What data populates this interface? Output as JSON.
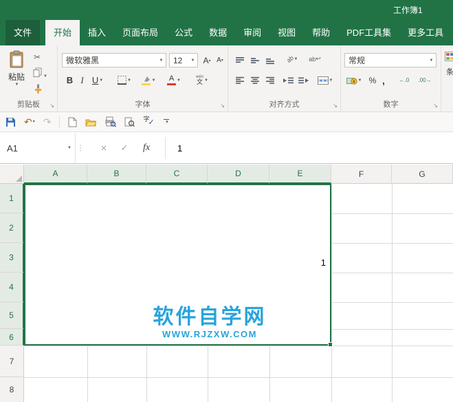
{
  "title_bar": {
    "workbook_name": "工作簿1"
  },
  "tabs": {
    "file": "文件",
    "items": [
      "开始",
      "插入",
      "页面布局",
      "公式",
      "数据",
      "审阅",
      "视图",
      "帮助",
      "PDF工具集",
      "更多工具"
    ],
    "active": "开始"
  },
  "ribbon": {
    "clipboard": {
      "group_label": "剪贴板",
      "paste_label": "粘贴"
    },
    "font": {
      "group_label": "字体",
      "name": "微软雅黑",
      "size": "12",
      "bold": "B",
      "italic": "I",
      "underline": "U",
      "grow": "A",
      "shrink": "A",
      "color_letter": "A",
      "phonetic_top": "wén",
      "phonetic_char": "文"
    },
    "alignment": {
      "group_label": "对齐方式",
      "orientation_text": "ab",
      "wrap_text": "ab"
    },
    "number": {
      "group_label": "数字",
      "format": "常规",
      "currency": "¥",
      "percent": "%",
      "comma": ",",
      "inc_decimal": "←.0",
      "dec_decimal": ".00→"
    },
    "conditional": {
      "label": "条"
    }
  },
  "formula_bar": {
    "name_box": "A1",
    "fx": "fx",
    "value": "1"
  },
  "grid": {
    "columns": [
      "A",
      "B",
      "C",
      "D",
      "E",
      "F",
      "G"
    ],
    "rows": [
      "1",
      "2",
      "3",
      "4",
      "5",
      "6",
      "7",
      "8"
    ],
    "selection_range": "A1:E6",
    "cell_value": "1",
    "watermark_line1": "软件自学网",
    "watermark_line2": "WWW.RJZXW.COM"
  },
  "icons": {
    "caret": "▼",
    "caret_small": "▾",
    "caret_up": "▴",
    "scissors": "✂",
    "undo": "↶",
    "redo": "↷",
    "check": "✓",
    "cancel": "×",
    "splitter_dots": "⋮",
    "launcher": "↘",
    "wrap_return": "↩",
    "spell_char": "字",
    "spell_check": "✓"
  },
  "colors": {
    "excel_green": "#217346",
    "watermark_blue": "#29a3dc",
    "fill_yellow": "#ffd34d",
    "font_red": "#e03c31"
  }
}
